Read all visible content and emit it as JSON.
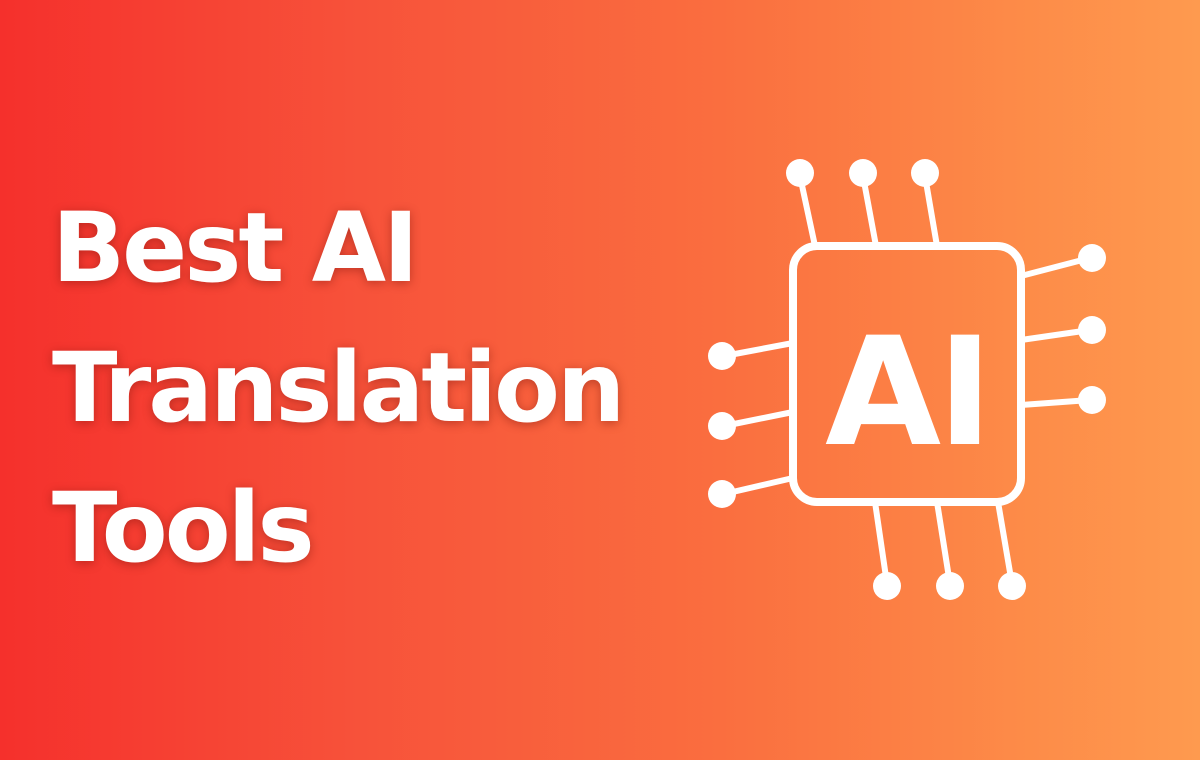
{
  "banner": {
    "headline_lines": [
      "Best AI",
      "Translation",
      "Tools"
    ],
    "chip_icon": {
      "icon": "ai-chip-icon",
      "label": "AI"
    },
    "colors": {
      "gradient_left": "#f5302c",
      "gradient_right": "#fe9a4f",
      "foreground": "#ffffff"
    }
  }
}
